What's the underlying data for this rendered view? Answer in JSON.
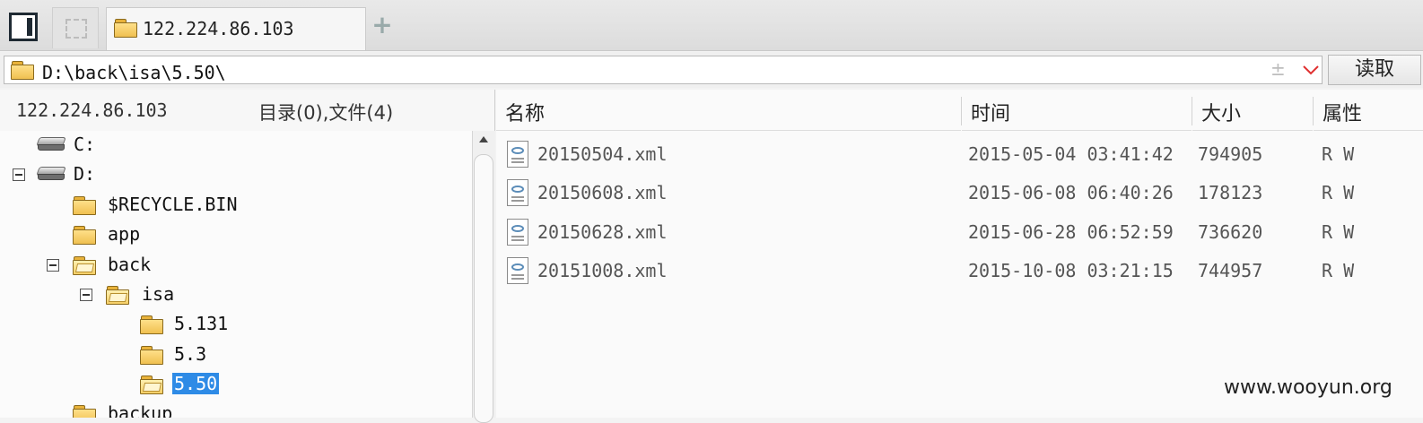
{
  "tabs": {
    "active_tab_label": "122.224.86.103",
    "add_tab_symbol": "+"
  },
  "path_bar": {
    "path": "D:\\back\\isa\\5.50\\",
    "plus_minus_symbol": "±",
    "read_button_label": "读取"
  },
  "left_pane": {
    "host": "122.224.86.103",
    "summary": "目录(0),文件(4)",
    "tree": [
      {
        "label": "C:",
        "type": "drive",
        "expanded": false
      },
      {
        "label": "D:",
        "type": "drive",
        "expanded": true
      },
      {
        "label": "$RECYCLE.BIN",
        "type": "folder",
        "expanded": false
      },
      {
        "label": "app",
        "type": "folder",
        "expanded": false
      },
      {
        "label": "back",
        "type": "folder",
        "expanded": true
      },
      {
        "label": "isa",
        "type": "folder",
        "expanded": true
      },
      {
        "label": "5.131",
        "type": "folder",
        "expanded": false
      },
      {
        "label": "5.3",
        "type": "folder",
        "expanded": false
      },
      {
        "label": "5.50",
        "type": "folder",
        "expanded": false,
        "selected": true
      },
      {
        "label": "backup",
        "type": "folder",
        "expanded": false
      }
    ]
  },
  "columns": {
    "name": "名称",
    "time": "时间",
    "size": "大小",
    "attr": "属性"
  },
  "files": [
    {
      "name": "20150504.xml",
      "time": "2015-05-04 03:41:42",
      "size": "794905",
      "attr": "R W"
    },
    {
      "name": "20150608.xml",
      "time": "2015-06-08 06:40:26",
      "size": "178123",
      "attr": "R W"
    },
    {
      "name": "20150628.xml",
      "time": "2015-06-28 06:52:59",
      "size": "736620",
      "attr": "R W"
    },
    {
      "name": "20151008.xml",
      "time": "2015-10-08 03:21:15",
      "size": "744957",
      "attr": "R W"
    }
  ],
  "watermark": "www.wooyun.org",
  "colors": {
    "selection": "#2e8be6",
    "folder": "#f0c050",
    "chevron": "#e03030"
  }
}
